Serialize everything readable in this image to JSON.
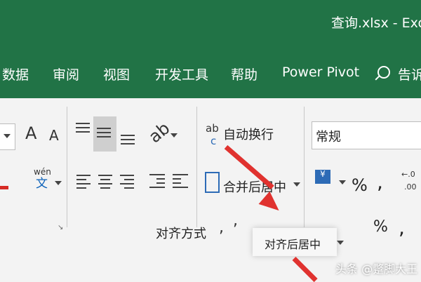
{
  "window": {
    "title": "查询.xlsx  -  Exc"
  },
  "ribbon_tabs": [
    {
      "label": "数据"
    },
    {
      "label": "审阅"
    },
    {
      "label": "视图"
    },
    {
      "label": "开发工具"
    },
    {
      "label": "帮助"
    },
    {
      "label": "Power Pivot"
    },
    {
      "label": "告诉"
    }
  ],
  "font_group": {
    "grow_font": "A",
    "shrink_font": "A",
    "phonetic_top": "wén",
    "phonetic_bottom": "文"
  },
  "alignment_group": {
    "wrap_text": "自动换行",
    "merge_center": "合并后居中",
    "group_label": "对齐方式",
    "wrap_prefix": "ab",
    "wrap_suffix": "c"
  },
  "number_group": {
    "format_value": "常规",
    "percent": "%",
    "comma": ",",
    "decimal_top": "←.0",
    "decimal_bottom": ".00"
  },
  "popup": {
    "merge_center": "对齐后居中"
  },
  "footer": {
    "percent": "%",
    "comma": ","
  },
  "watermark": "头条 @蹩脚大王",
  "colors": {
    "excel_green": "#217346",
    "arrow_red": "#e0322f"
  }
}
